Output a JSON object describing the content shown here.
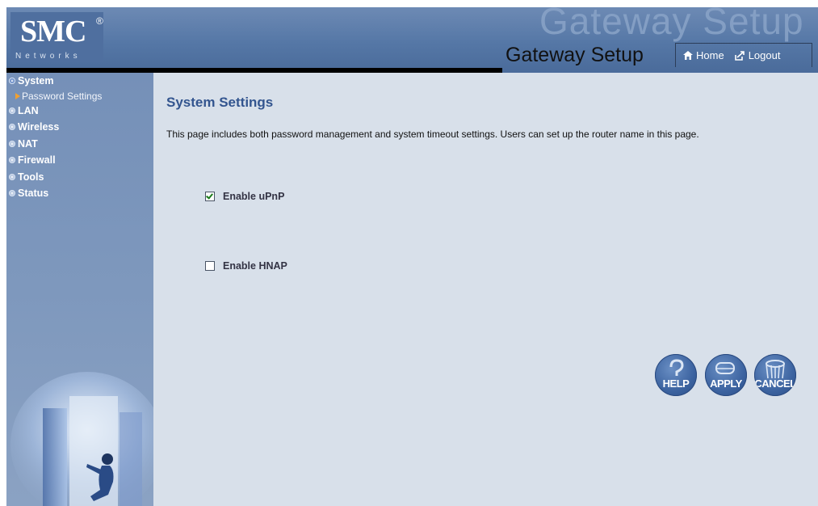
{
  "header": {
    "brand": "SMC",
    "brand_mark": "®",
    "brand_sub": "Networks",
    "watermark": "Gateway Setup",
    "title": "Gateway Setup",
    "home_label": "Home",
    "logout_label": "Logout"
  },
  "sidebar": {
    "items": [
      {
        "label": "System",
        "active": true
      },
      {
        "label": "LAN"
      },
      {
        "label": "Wireless"
      },
      {
        "label": "NAT"
      },
      {
        "label": "Firewall"
      },
      {
        "label": "Tools"
      },
      {
        "label": "Status"
      }
    ],
    "submenu": [
      {
        "label": "Password Settings"
      }
    ]
  },
  "main": {
    "title": "System Settings",
    "description": "This page includes both password management and system timeout settings. Users can set up the router name in this page.",
    "options": [
      {
        "label": "Enable uPnP",
        "checked": true
      },
      {
        "label": "Enable HNAP",
        "checked": false
      }
    ],
    "buttons": {
      "help": "HELP",
      "apply": "APPLY",
      "cancel": "CANCEL"
    }
  },
  "colors": {
    "header_bg": "#5577a6",
    "sidebar_bg": "#7e98bd",
    "main_bg": "#d8e0ea",
    "title_color": "#33558f",
    "submenu_arrow": "#f0a030"
  },
  "icons": [
    "home-icon",
    "logout-icon",
    "help-icon",
    "apply-icon",
    "cancel-icon",
    "bullet-icon",
    "arrow-icon"
  ]
}
